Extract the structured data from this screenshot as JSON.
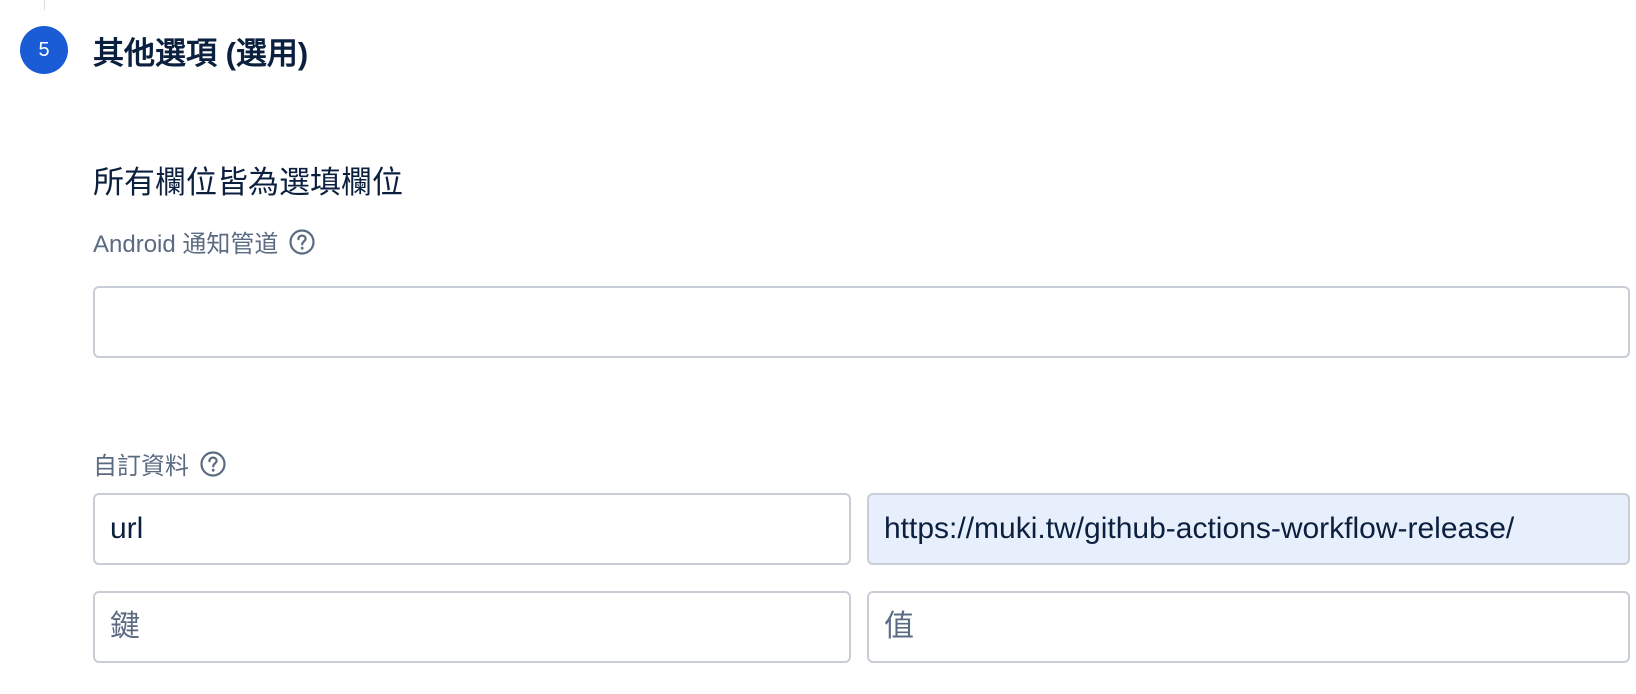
{
  "step": {
    "number": "5",
    "title": "其他選項 (選用)"
  },
  "section": {
    "subtitle": "所有欄位皆為選填欄位"
  },
  "android_channel": {
    "label": "Android 通知管道",
    "value": "",
    "placeholder": "",
    "icon": "help-circle-icon"
  },
  "custom_data": {
    "label": "自訂資料",
    "icon": "help-circle-icon",
    "rows": [
      {
        "key": "url",
        "value": "https://muki.tw/github-actions-workflow-release/",
        "key_placeholder": "鍵",
        "value_placeholder": "值"
      },
      {
        "key": "",
        "value": "",
        "key_placeholder": "鍵",
        "value_placeholder": "值"
      }
    ]
  },
  "colors": {
    "accent": "#1a5bd6",
    "heading": "#0b1f3f",
    "label": "#5b6b82",
    "border": "#c8cdd6",
    "autofill_bg": "#e8effc"
  }
}
